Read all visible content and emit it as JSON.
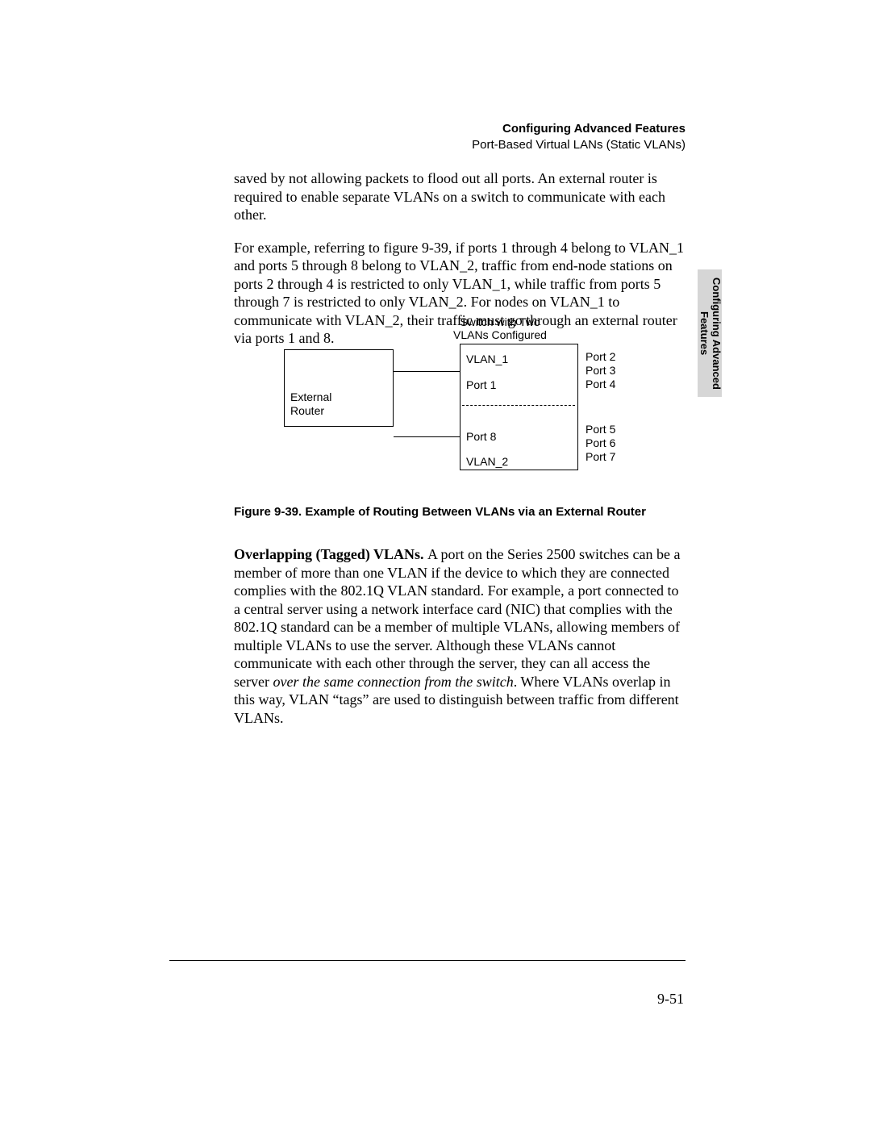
{
  "header": {
    "title": "Configuring Advanced Features",
    "subtitle": "Port-Based Virtual LANs (Static VLANs)"
  },
  "sideTab": "Configuring Advanced\nFeatures",
  "para1": "saved by not allowing packets to flood out all ports. An external router is required to enable separate VLANs on a switch to communicate with each other.",
  "para2": "For example, referring to figure 9-39, if ports 1 through 4 belong to VLAN_1 and ports 5 through 8 belong to VLAN_2, traffic from end-node stations on ports 2 through 4 is restricted to only VLAN_1, while traffic from ports 5 through 7 is restricted to only VLAN_2. For nodes on VLAN_1 to communicate with VLAN_2, their traffic must go through an external router via ports 1 and 8.",
  "diagram": {
    "switchTop": "Switch with Two",
    "switchBottom": "VLANs Configured",
    "routerTop": "External",
    "routerBottom": "Router",
    "vlan1": "VLAN_1",
    "vlan2": "VLAN_2",
    "port1": "Port 1",
    "port8": "Port 8",
    "p2": "Port 2",
    "p3": "Port 3",
    "p4": "Port 4",
    "p5": "Port 5",
    "p6": "Port 6",
    "p7": "Port 7"
  },
  "figCaption": "Figure 9-39.  Example of Routing Between VLANs via an External Router",
  "overlap": {
    "runin": "Overlapping (Tagged) VLANs.  ",
    "textA": "A port on the Series 2500 switches can be a member of more than one VLAN if the device to which they are connected complies with the 802.1Q VLAN standard. For example, a port connected to a central server using a network interface card (NIC) that complies with the 802.1Q standard can be a member of multiple VLANs, allowing members of multiple VLANs to use the server. Although these VLANs cannot communicate with each other through the server, they can all access the server ",
    "italic": "over the same connection from the switch",
    "textB": ". Where VLANs overlap in this way, VLAN “tags” are used to distinguish between traffic from different VLANs."
  },
  "pageNum": "9-51"
}
